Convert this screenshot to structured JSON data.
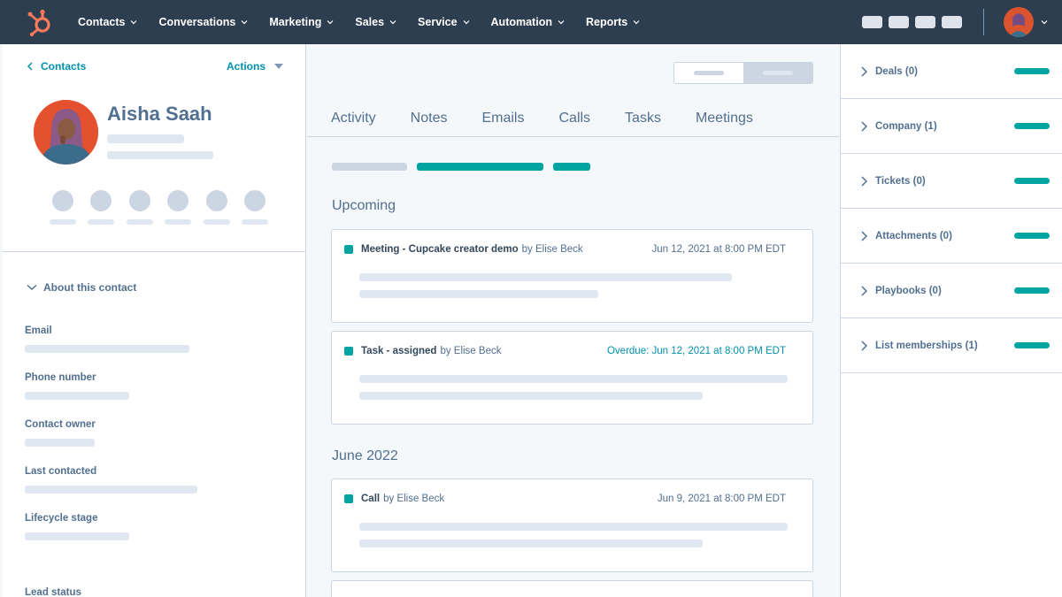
{
  "nav": {
    "items": [
      {
        "label": "Contacts"
      },
      {
        "label": "Conversations"
      },
      {
        "label": "Marketing"
      },
      {
        "label": "Sales"
      },
      {
        "label": "Service"
      },
      {
        "label": "Automation"
      },
      {
        "label": "Reports"
      }
    ]
  },
  "contact": {
    "back_label": "Contacts",
    "actions_label": "Actions",
    "name": "Aisha Saah"
  },
  "about": {
    "header": "About this contact",
    "fields": [
      {
        "label": "Email"
      },
      {
        "label": "Phone number"
      },
      {
        "label": "Contact owner"
      },
      {
        "label": "Last contacted"
      },
      {
        "label": "Lifecycle stage"
      },
      {
        "label": "Lead status"
      }
    ]
  },
  "tabs": [
    {
      "label": "Activity"
    },
    {
      "label": "Notes"
    },
    {
      "label": "Emails"
    },
    {
      "label": "Calls"
    },
    {
      "label": "Tasks"
    },
    {
      "label": "Meetings"
    }
  ],
  "timeline": {
    "sections": [
      {
        "heading": "Upcoming"
      },
      {
        "heading": "June 2022"
      }
    ],
    "cards": [
      {
        "title": "Meeting - Cupcake creator demo",
        "by": "by Elise Beck",
        "date": "Jun 12, 2021 at 8:00 PM EDT"
      },
      {
        "title": "Task - assigned",
        "by": "by Elise Beck",
        "date": "Overdue: Jun 12, 2021 at 8:00 PM EDT"
      },
      {
        "title": "Call",
        "by": "by Elise Beck",
        "date": "Jun 9, 2021 at 8:00 PM EDT"
      }
    ]
  },
  "sidebar": {
    "items": [
      {
        "label": "Deals (0)"
      },
      {
        "label": "Company (1)"
      },
      {
        "label": "Tickets (0)"
      },
      {
        "label": "Attachments (0)"
      },
      {
        "label": "Playbooks (0)"
      },
      {
        "label": "List memberships (1)"
      }
    ]
  },
  "colors": {
    "nav_bg": "#2d3e50",
    "accent_teal": "#00a4a0",
    "link": "#0091ae",
    "brand_orange": "#ff7a59"
  }
}
